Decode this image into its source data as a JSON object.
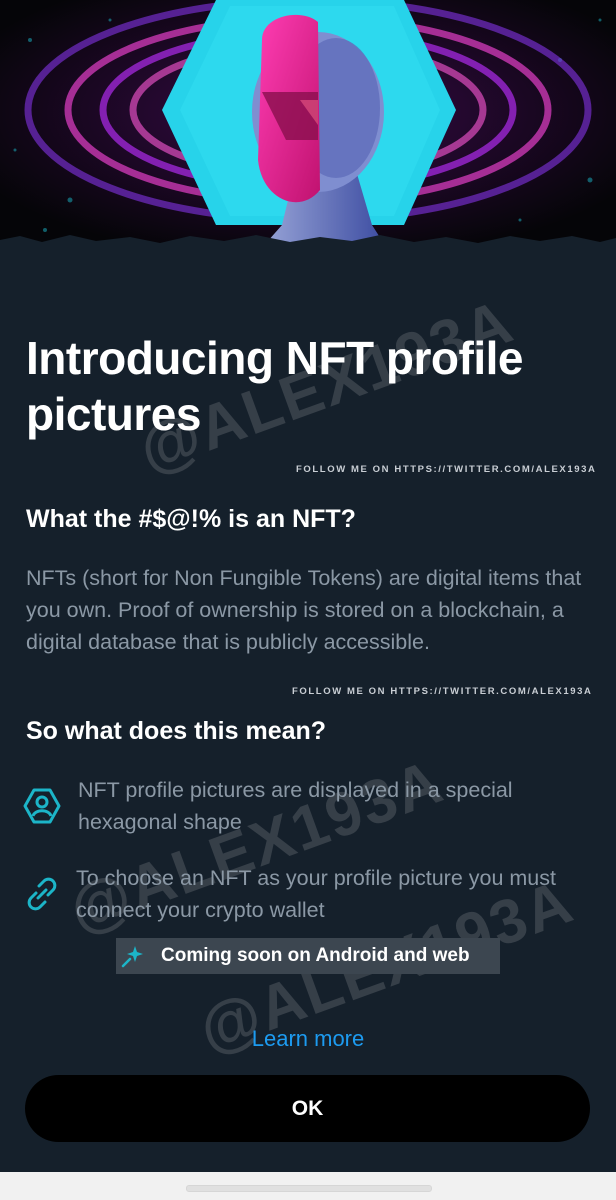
{
  "dialog": {
    "title": "Introducing NFT profile pictures",
    "credit": "FOLLOW ME ON HTTPS://TWITTER.COM/ALEX193A",
    "watermark": "@ALEX193A",
    "section1_heading": "What the #$@!% is an NFT?",
    "section1_body": "NFTs (short for Non Fungible Tokens) are digital items that you own. Proof of ownership is stored on a blockchain, a digital database that is publicly accessible.",
    "section2_heading": "So what does this mean?",
    "features": [
      {
        "icon": "hexagon-profile-icon",
        "text": "NFT profile pictures are displayed in a special hexagonal shape"
      },
      {
        "icon": "link-icon",
        "text": "To choose an NFT as your profile picture you must connect your crypto wallet"
      }
    ],
    "coming_soon": {
      "icon": "sparkle-icon",
      "text": "Coming soon on Android and web"
    },
    "learn_more": "Learn more",
    "ok_button": "OK"
  },
  "colors": {
    "background": "#15202b",
    "accent": "#1d9bf0",
    "icon_teal": "#1cb5c8",
    "muted_text": "#8b98a5",
    "button_bg": "#000000"
  }
}
